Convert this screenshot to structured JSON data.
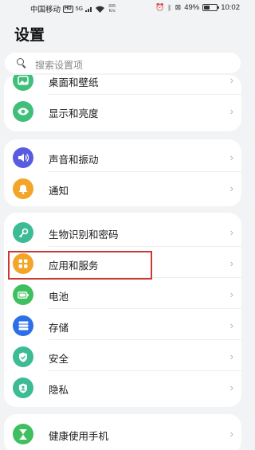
{
  "status_bar": {
    "carrier": "中国移动",
    "hd_badge": "HD",
    "signal": "5G",
    "net_speed_value": "305",
    "net_speed_unit": "K/s",
    "battery_percent": "49%",
    "battery_level": 0.49,
    "time": "10:02",
    "icons": [
      "signal-icon",
      "wifi-icon",
      "alarm-icon",
      "bluetooth-icon",
      "vibrate-icon",
      "battery-icon"
    ]
  },
  "page_title": "设置",
  "search": {
    "placeholder": "搜索设置项",
    "icon": "search-icon"
  },
  "groups": [
    {
      "items": [
        {
          "label": "桌面和壁纸",
          "icon": "wallpaper-icon",
          "color": "#3fbf7a"
        },
        {
          "label": "显示和亮度",
          "icon": "eye-icon",
          "color": "#3fbf7a"
        }
      ]
    },
    {
      "items": [
        {
          "label": "声音和振动",
          "icon": "speaker-icon",
          "color": "#5a5ce0"
        },
        {
          "label": "通知",
          "icon": "bell-icon",
          "color": "#f3a52a"
        }
      ]
    },
    {
      "items": [
        {
          "label": "生物识别和密码",
          "icon": "key-icon",
          "color": "#3dbb94"
        },
        {
          "label": "应用和服务",
          "icon": "apps-icon",
          "color": "#f3a52a",
          "highlighted": true
        },
        {
          "label": "电池",
          "icon": "battery-icon",
          "color": "#3fbf5f"
        },
        {
          "label": "存储",
          "icon": "storage-icon",
          "color": "#2d6fe6"
        },
        {
          "label": "安全",
          "icon": "shield-icon",
          "color": "#3dbb94"
        },
        {
          "label": "隐私",
          "icon": "privacy-icon",
          "color": "#3dbb94"
        }
      ]
    },
    {
      "items": [
        {
          "label": "健康使用手机",
          "icon": "hourglass-icon",
          "color": "#3fbf5f"
        }
      ]
    }
  ],
  "colors": {
    "background": "#f1f3f5",
    "card": "#ffffff",
    "highlight": "#c93b32"
  }
}
